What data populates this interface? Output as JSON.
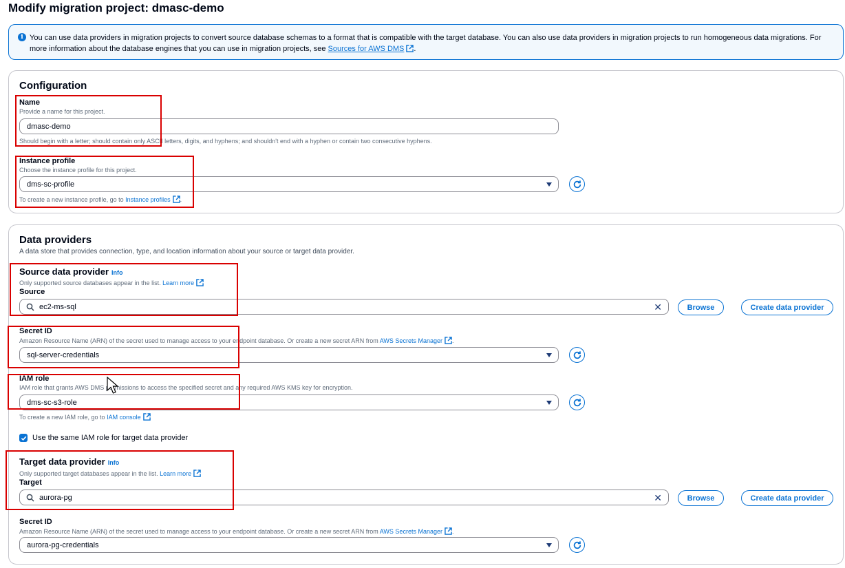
{
  "page": {
    "title": "Modify migration project: dmasc-demo"
  },
  "info_banner": {
    "icon": "info-icon",
    "text_part1": "You can use data providers in migration projects to convert source database schemas to a format that is compatible with the target database. You can also use data providers in migration projects to run homogeneous data migrations. For more information about the database engines that you can use in migration projects, see ",
    "link": "Sources for AWS DMS",
    "text_part2": "."
  },
  "configuration": {
    "title": "Configuration",
    "name": {
      "label": "Name",
      "description": "Provide a name for this project.",
      "value": "dmasc-demo",
      "constraint": "Should begin with a letter; should contain only ASCII letters, digits, and hyphens; and shouldn't end with a hyphen or contain two consecutive hyphens."
    },
    "instance_profile": {
      "label": "Instance profile",
      "description": "Choose the instance profile for this project.",
      "value": "dms-sc-profile",
      "hint_prefix": "To create a new instance profile, go to ",
      "hint_link": "Instance profiles",
      "hint_suffix": "."
    }
  },
  "data_providers": {
    "title": "Data providers",
    "description": "A data store that provides connection, type, and location information about your source or target data provider.",
    "source": {
      "heading": "Source data provider",
      "info": "Info",
      "description_prefix": "Only supported source databases appear in the list. ",
      "learn_more": "Learn more",
      "field_label": "Source",
      "value": "ec2-ms-sql",
      "browse": "Browse",
      "create": "Create data provider",
      "secret": {
        "label": "Secret ID",
        "description_prefix": "Amazon Resource Name (ARN) of the secret used to manage access to your endpoint database. Or create a new secret ARN from ",
        "link": "AWS Secrets Manager",
        "description_suffix": ".",
        "value": "sql-server-credentials"
      },
      "iam": {
        "label": "IAM role",
        "description": "IAM role that grants AWS DMS permissions to access the specified secret and any required AWS KMS key for encryption.",
        "value": "dms-sc-s3-role",
        "hint_prefix": "To create a new IAM role, go to ",
        "hint_link": "IAM console"
      },
      "same_role_checkbox": {
        "label": "Use the same IAM role for target data provider",
        "checked": true
      }
    },
    "target": {
      "heading": "Target data provider",
      "info": "Info",
      "description_prefix": "Only supported target databases appear in the list. ",
      "learn_more": "Learn more",
      "field_label": "Target",
      "value": "aurora-pg",
      "browse": "Browse",
      "create": "Create data provider",
      "secret": {
        "label": "Secret ID",
        "description_prefix": "Amazon Resource Name (ARN) of the secret used to manage access to your endpoint database. Or create a new secret ARN from ",
        "link": "AWS Secrets Manager",
        "description_suffix": ".",
        "value": "aurora-pg-credentials"
      }
    }
  },
  "colors": {
    "accent": "#0972d3",
    "highlight_box": "#d90000",
    "text": "#000716",
    "muted": "#5f6b7a"
  }
}
